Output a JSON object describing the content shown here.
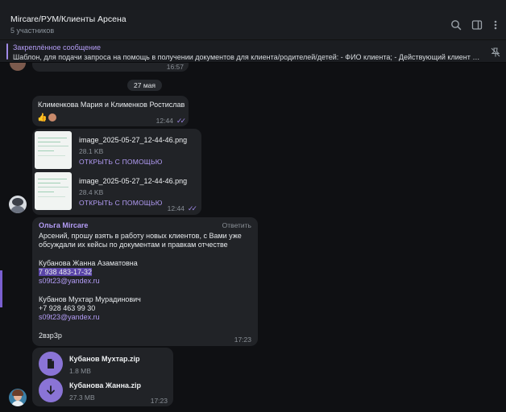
{
  "header": {
    "title": "Mircare/РУМ/Клиенты Арсена",
    "subtitle": "5 участников",
    "icons": [
      "search-icon",
      "sidebar-toggle-icon",
      "more-vertical-icon"
    ]
  },
  "pinned": {
    "title": "Закреплённое сообщение",
    "text": "Шаблон, для подачи запроса на помощь в получении документов для клиента/родителей/детей: - ФИО клиента; - Действующий клиент ил...",
    "icon": "unpin-icon"
  },
  "messages": {
    "prev_time": "16:57",
    "date_divider": "27 мая",
    "m1": {
      "text": "Клименкова Мария  и Клименков Ростислав",
      "reaction": "👍",
      "time": "12:44",
      "checks": "✓✓"
    },
    "m2": {
      "files": [
        {
          "name": "image_2025-05-27_12-44-46.png",
          "size": "28.1 KB",
          "action": "ОТКРЫТЬ С ПОМОЩЬЮ"
        },
        {
          "name": "image_2025-05-27_12-44-46.png",
          "size": "28.4 KB",
          "action": "ОТКРЫТЬ С ПОМОЩЬЮ"
        }
      ],
      "time": "12:44",
      "checks": "✓✓"
    },
    "m3": {
      "sender": "Ольга Mircare",
      "reply": "Ответить",
      "lines": [
        "Арсений, прошу взять в работу новых клиентов, с Вами уже",
        "обсуждали их кейсы по документам и правкам отчестве"
      ],
      "client1_name": "Кубанова Жанна Азаматовна",
      "client1_phone": "7 938 483-17-32",
      "client1_email": "s09t23@yandex.ru",
      "client2_name": "Кубанов Мухтар Мурадинович",
      "client2_phone": "+7 928 463 99 30",
      "client2_email": "s09t23@yandex.ru",
      "code": "2взр3р",
      "time": "17:23"
    },
    "m4": {
      "files": [
        {
          "name": "Кубанов Мухтар.zip",
          "size": "1.8 MB",
          "icon": "document-icon"
        },
        {
          "name": "Кубанова Жанна.zip",
          "size": "27.3 MB",
          "icon": "download-icon"
        }
      ],
      "time": "17:23"
    }
  }
}
